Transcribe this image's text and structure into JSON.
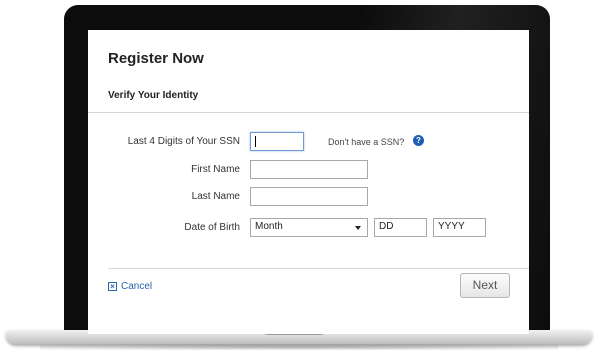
{
  "form": {
    "title": "Register Now",
    "subtitle": "Verify Your Identity",
    "ssn_label": "Last 4 Digits of Your SSN",
    "ssn_value": "",
    "no_ssn_text": "Don't have a SSN?",
    "help_icon": "question-circle-icon",
    "first_name_label": "First Name",
    "first_name_value": "",
    "last_name_label": "Last Name",
    "last_name_value": "",
    "dob_label": "Date of Birth",
    "month_selected": "Month",
    "day_value": "DD",
    "year_value": "YYYY"
  },
  "actions": {
    "cancel_label": "Cancel",
    "next_label": "Next"
  },
  "colors": {
    "link": "#2a62ab",
    "help_icon": "#1f5fb3",
    "focus_border": "#6f9bd2"
  }
}
